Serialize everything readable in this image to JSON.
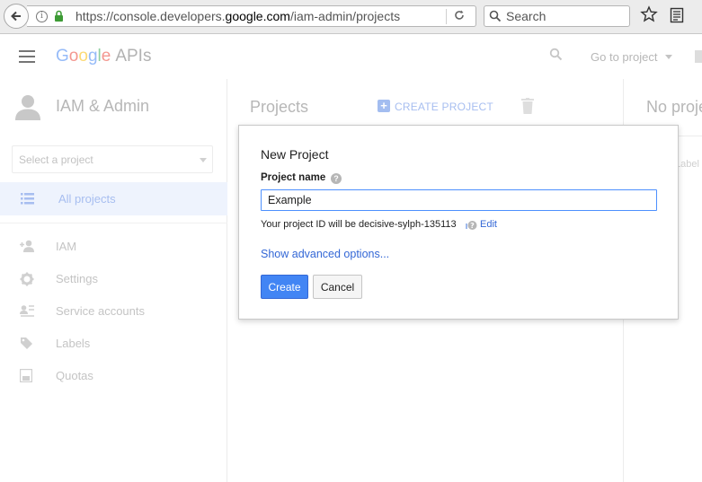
{
  "browser": {
    "url_prefix": "https://console.developers.",
    "url_host": "google.com",
    "url_path": "/iam-admin/projects",
    "search_placeholder": "Search"
  },
  "header": {
    "logo_letters": [
      "G",
      "o",
      "o",
      "g",
      "l",
      "e"
    ],
    "logo_suffix": "APIs",
    "goto_project": "Go to project"
  },
  "sidebar": {
    "title": "IAM & Admin",
    "project_select_placeholder": "Select a project",
    "active_item": "All projects",
    "items": [
      {
        "label": "IAM",
        "icon": "person-add-icon"
      },
      {
        "label": "Settings",
        "icon": "gear-icon"
      },
      {
        "label": "Service accounts",
        "icon": "service-account-icon"
      },
      {
        "label": "Labels",
        "icon": "tag-icon"
      },
      {
        "label": "Quotas",
        "icon": "quota-icon"
      }
    ]
  },
  "projects_panel": {
    "title": "Projects",
    "create_label": "CREATE PROJECT"
  },
  "right_panel": {
    "title": "No proje",
    "labels_text": "Label"
  },
  "dialog": {
    "title": "New Project",
    "field_label": "Project name",
    "input_value": "Example",
    "project_id_text": "Your project ID will be decisive-sylph-135113",
    "edit_label": "Edit",
    "advanced_label": "Show advanced options...",
    "create_label": "Create",
    "cancel_label": "Cancel"
  },
  "colors": {
    "primary": "#4285f4",
    "link": "#3367d6",
    "active_nav_bg": "#eef3fd"
  }
}
